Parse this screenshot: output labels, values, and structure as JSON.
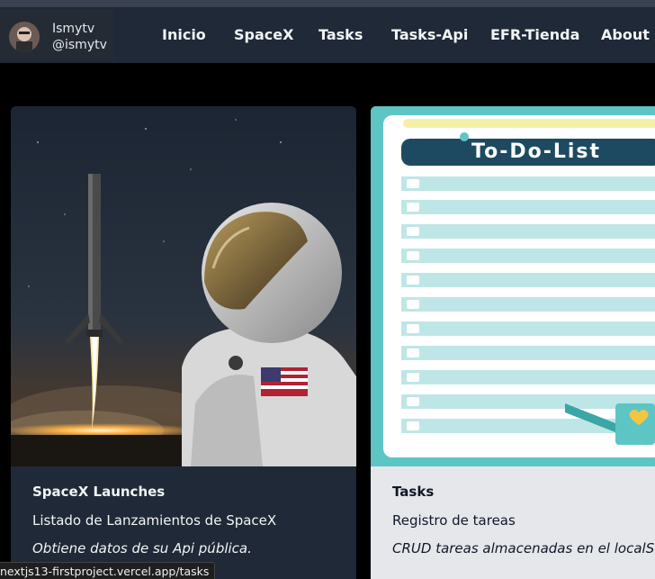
{
  "user": {
    "name": "Ismytv",
    "handle": "@ismytv"
  },
  "nav": {
    "items": [
      {
        "label": "Inicio"
      },
      {
        "label": "SpaceX"
      },
      {
        "label": "Tasks"
      },
      {
        "label": "Tasks-Api"
      },
      {
        "label": "EFR-Tienda"
      },
      {
        "label": "About"
      }
    ]
  },
  "cards": [
    {
      "title": "SpaceX Launches",
      "description": "Listado de Lanzamientos de SpaceX",
      "note": "Obtiene datos de su Api pública."
    },
    {
      "title": "Tasks",
      "description": "Registro de tareas",
      "note": "CRUD tareas almacenadas en el localStorage",
      "image_text": "To-Do-List"
    }
  ],
  "status_url": "nextjs13-firstproject.vercel.app/tasks",
  "colors": {
    "navbar": "#1f2937",
    "background": "#000000",
    "teal": "#5ec5c5"
  }
}
